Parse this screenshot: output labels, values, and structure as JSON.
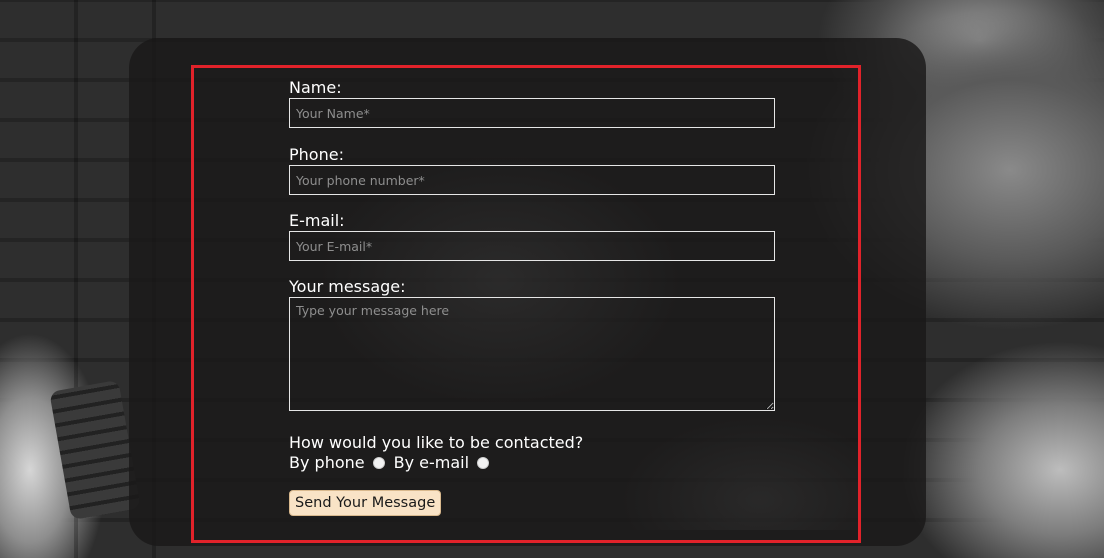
{
  "form": {
    "name": {
      "label": "Name:",
      "placeholder": "Your Name*",
      "value": ""
    },
    "phone": {
      "label": "Phone:",
      "placeholder": "Your phone number*",
      "value": ""
    },
    "email": {
      "label": "E-mail:",
      "placeholder": "Your E-mail*",
      "value": ""
    },
    "message": {
      "label": "Your message:",
      "placeholder": "Type your message here",
      "value": ""
    },
    "contact_question": "How would you like to be contacted?",
    "contact_options": [
      "By phone",
      "By e-mail"
    ],
    "submit_label": "Send Your Message"
  },
  "colors": {
    "highlight_border": "#e1222a",
    "button_bg": "#f9e3c6",
    "card_bg": "rgba(26,24,24,0.82)"
  }
}
